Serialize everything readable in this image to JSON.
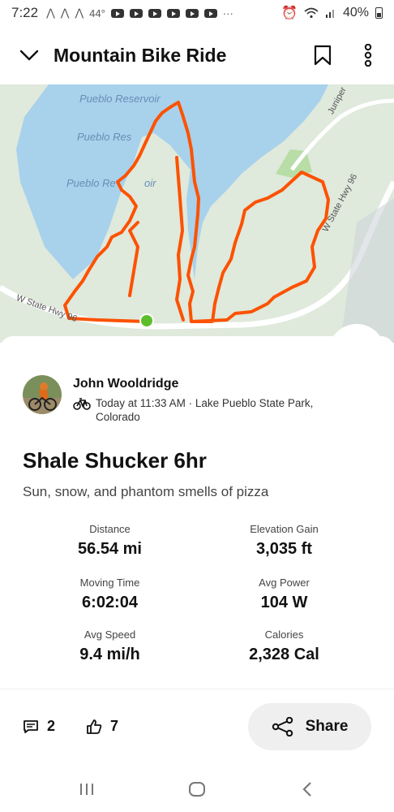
{
  "status_bar": {
    "time": "7:22",
    "temperature": "44°",
    "more": "···",
    "battery": "40%"
  },
  "header": {
    "title": "Mountain Bike Ride"
  },
  "map": {
    "water_labels": [
      "Pueblo Reservoir",
      "Pueblo Res",
      "Pueblo Re",
      "oir"
    ],
    "road_labels": [
      "W State Hwy 96",
      "W State Hwy 96",
      "Juniper"
    ],
    "colors": {
      "route": "#fc5200",
      "water": "#a8d1ec",
      "land": "#dfe9dc",
      "start_marker": "#5cbf2a"
    }
  },
  "athlete": {
    "name": "John Wooldridge",
    "meta": "Today at 11:33 AM · Lake Pueblo State Park, Colorado"
  },
  "activity": {
    "title": "Shale Shucker 6hr",
    "description": "Sun, snow, and phantom smells of pizza"
  },
  "stats": [
    {
      "label": "Distance",
      "value": "56.54 mi"
    },
    {
      "label": "Elevation Gain",
      "value": "3,035 ft"
    },
    {
      "label": "Moving Time",
      "value": "6:02:04"
    },
    {
      "label": "Avg Power",
      "value": "104 W"
    },
    {
      "label": "Avg Speed",
      "value": "9.4 mi/h"
    },
    {
      "label": "Calories",
      "value": "2,328 Cal"
    }
  ],
  "actions": {
    "comments_count": "2",
    "kudos_count": "7",
    "share_label": "Share"
  },
  "icons": [
    "chevron-down-icon",
    "bookmark-icon",
    "more-vertical-icon",
    "bike-icon",
    "comment-icon",
    "thumbs-up-icon",
    "share-icon"
  ]
}
